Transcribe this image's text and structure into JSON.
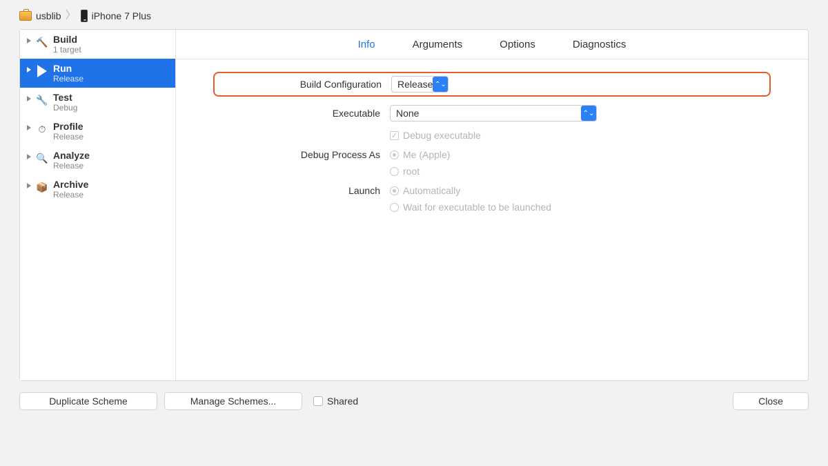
{
  "breadcrumb": {
    "scheme": "usblib",
    "device": "iPhone 7 Plus"
  },
  "sidebar": {
    "items": [
      {
        "title": "Build",
        "sub": "1 target"
      },
      {
        "title": "Run",
        "sub": "Release"
      },
      {
        "title": "Test",
        "sub": "Debug"
      },
      {
        "title": "Profile",
        "sub": "Release"
      },
      {
        "title": "Analyze",
        "sub": "Release"
      },
      {
        "title": "Archive",
        "sub": "Release"
      }
    ]
  },
  "tabs": {
    "info": "Info",
    "arguments": "Arguments",
    "options": "Options",
    "diagnostics": "Diagnostics"
  },
  "form": {
    "build_config_label": "Build Configuration",
    "build_config_value": "Release",
    "executable_label": "Executable",
    "executable_value": "None",
    "debug_exec_label": "Debug executable",
    "debug_process_label": "Debug Process As",
    "debug_process_me": "Me (Apple)",
    "debug_process_root": "root",
    "launch_label": "Launch",
    "launch_auto": "Automatically",
    "launch_wait": "Wait for executable to be launched"
  },
  "footer": {
    "duplicate": "Duplicate Scheme",
    "manage": "Manage Schemes...",
    "shared": "Shared",
    "close": "Close"
  }
}
